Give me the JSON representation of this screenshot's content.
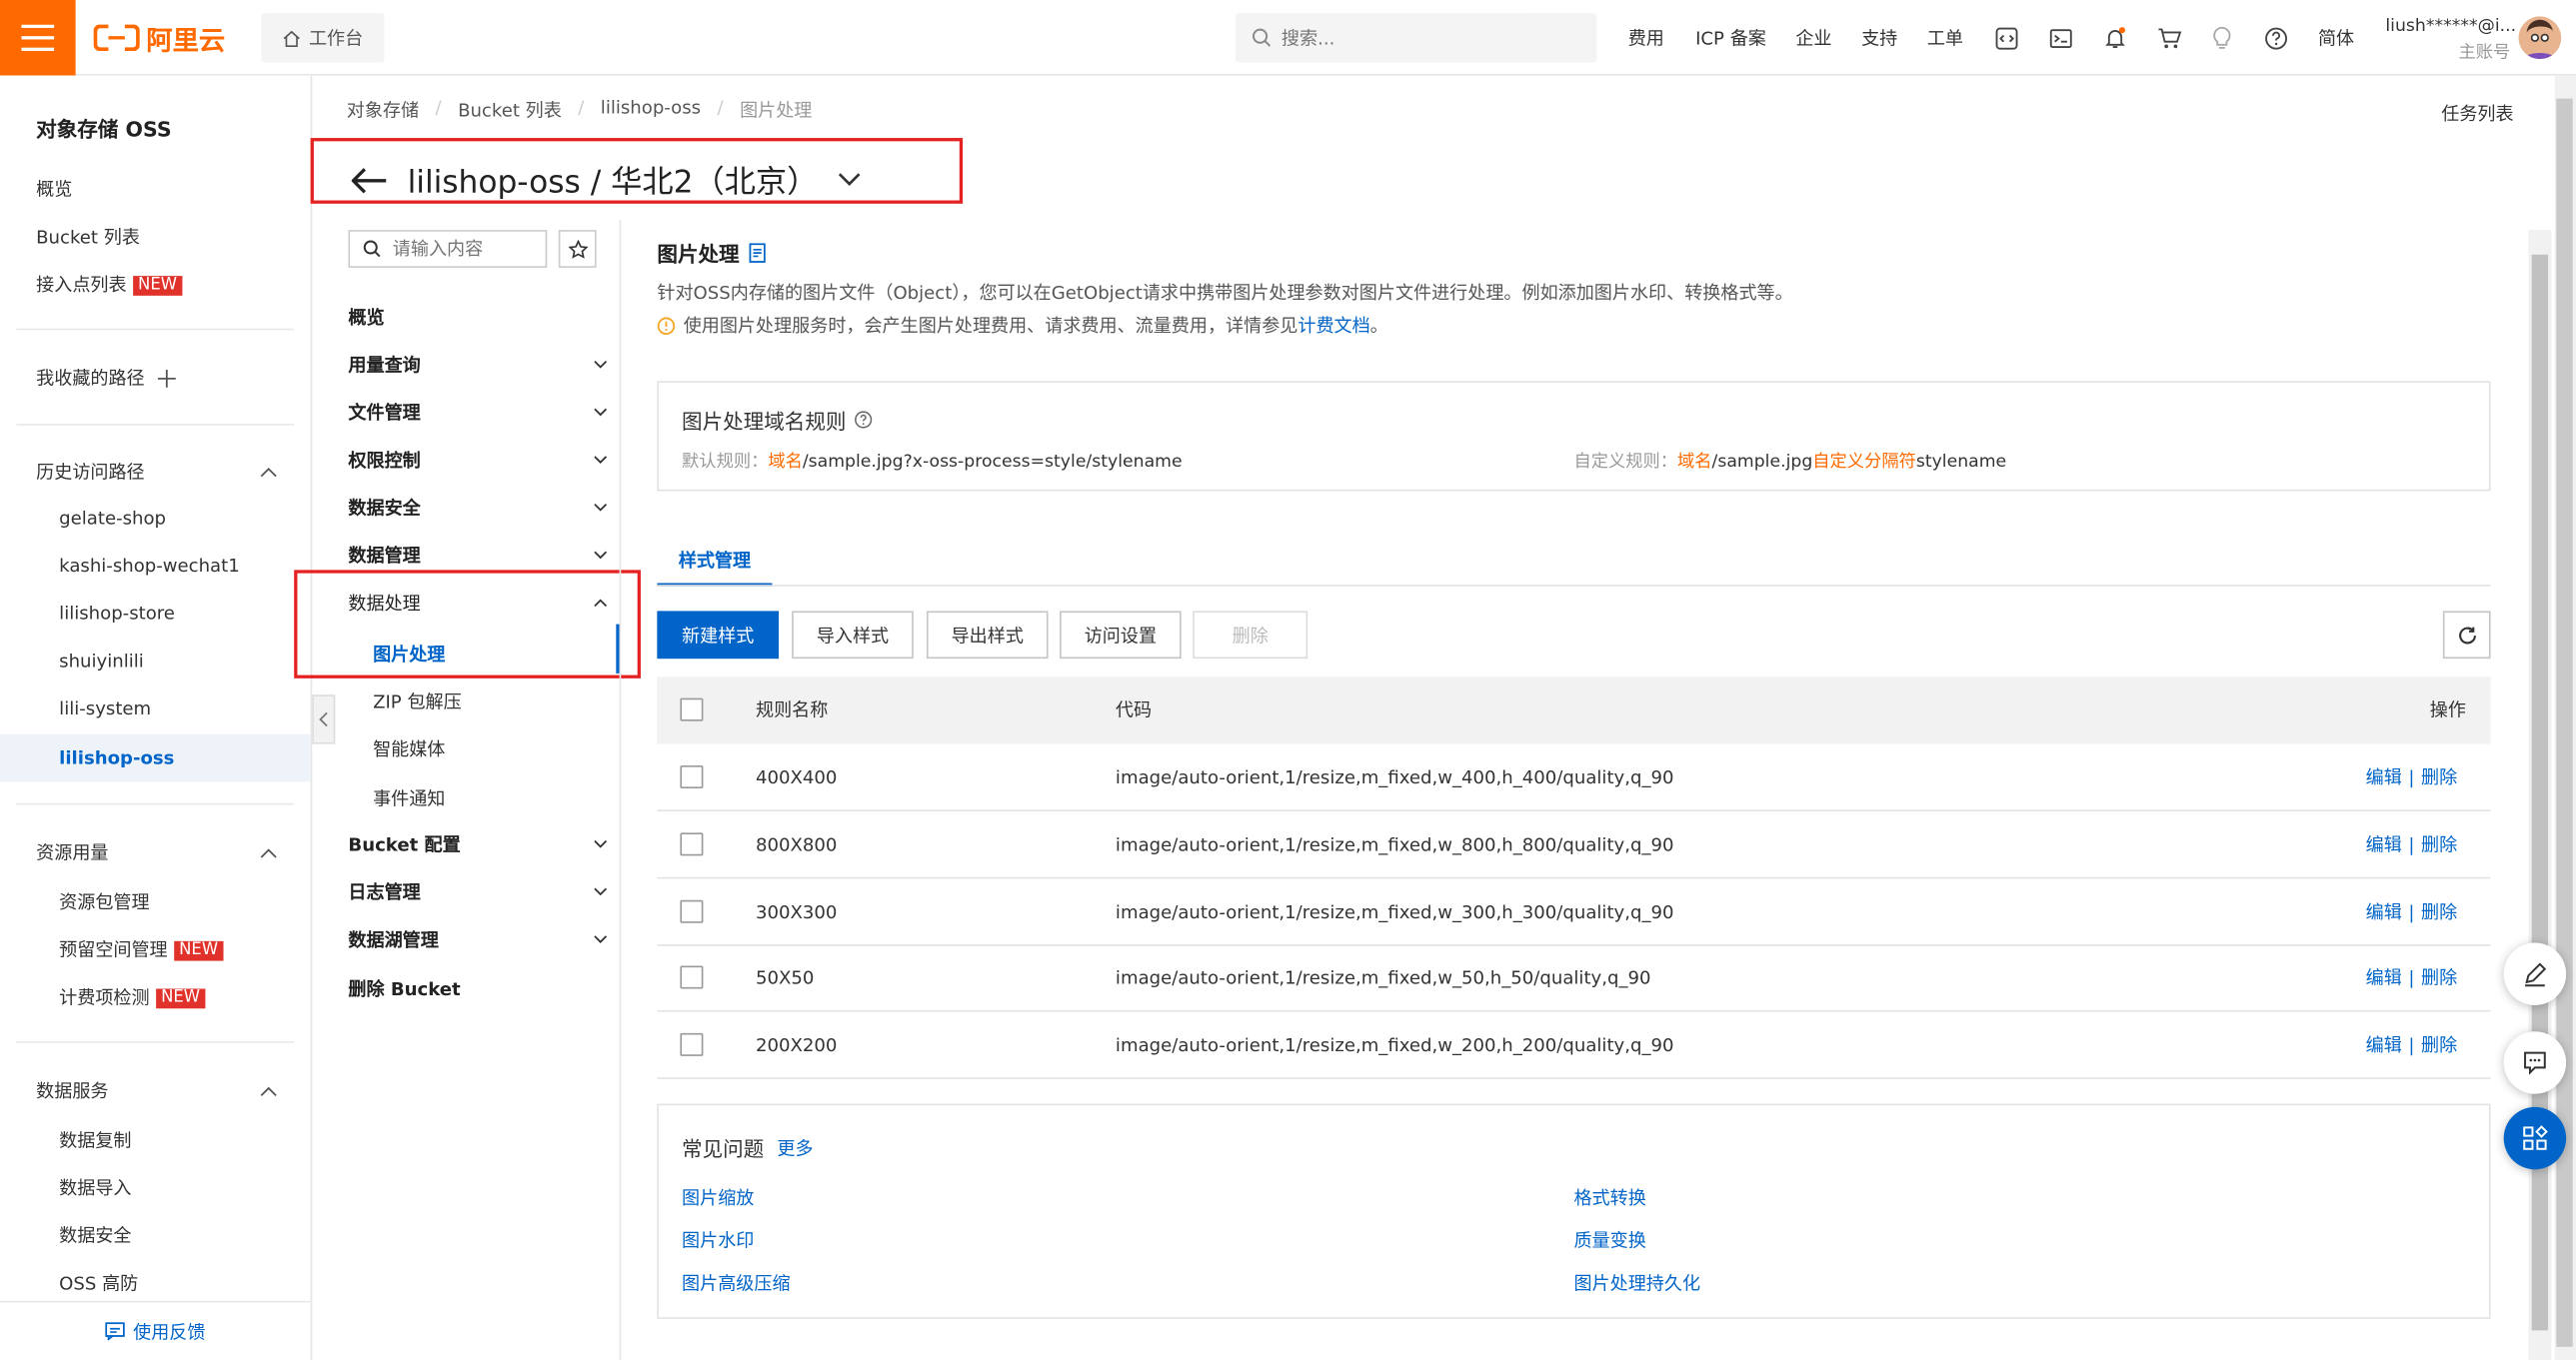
{
  "topbar": {
    "logo_text": "阿里云",
    "home_label": "工作台",
    "search_placeholder": "搜索...",
    "nav": [
      "费用",
      "ICP 备案",
      "企业",
      "支持",
      "工单"
    ],
    "lang": "简体",
    "user_name": "liush******@i...",
    "user_role": "主账号",
    "notification_dot_color": "#ff6a00"
  },
  "leftnav": {
    "title": "对象存储 OSS",
    "items": [
      "概览",
      "Bucket 列表",
      "接入点列表"
    ],
    "new_badge": "NEW",
    "favorites": "我收藏的路径",
    "history_title": "历史访问路径",
    "history": [
      "gelate-shop",
      "kashi-shop-wechat1",
      "lilishop-store",
      "shuiyinlili",
      "lili-system",
      "lilishop-oss"
    ],
    "resource_title": "资源用量",
    "resource": [
      "资源包管理",
      "预留空间管理",
      "计费项检测"
    ],
    "data_service_title": "数据服务",
    "data_service": [
      "数据复制",
      "数据导入",
      "数据安全",
      "OSS 高防"
    ],
    "feedback": "使用反馈"
  },
  "breadcrumb": [
    "对象存储",
    "Bucket 列表",
    "lilishop-oss",
    "图片处理"
  ],
  "task_list": "任务列表",
  "page_title": "lilishop-oss / 华北2（北京）",
  "subnav": {
    "search_placeholder": "请输入内容",
    "overview": "概览",
    "groups": [
      "用量查询",
      "文件管理",
      "权限控制",
      "数据安全",
      "数据管理"
    ],
    "data_processing": "数据处理",
    "processing_items": [
      "图片处理",
      "ZIP 包解压",
      "智能媒体",
      "事件通知"
    ],
    "groups2": [
      "Bucket 配置",
      "日志管理",
      "数据湖管理"
    ],
    "delete_bucket": "删除 Bucket"
  },
  "main": {
    "title": "图片处理",
    "description": "针对OSS内存储的图片文件（Object），您可以在GetObject请求中携带图片处理参数对图片文件进行处理。例如添加图片水印、转换格式等。",
    "notice": "使用图片处理服务时，会产生图片处理费用、请求费用、流量费用，详情参见",
    "notice_link": "计费文档",
    "notice_end": "。",
    "rule_box": {
      "title": "图片处理域名规则",
      "default_label": "默认规则：",
      "default_domain": "域名",
      "default_path": "/sample.jpg?x-oss-process=style/stylename",
      "custom_label": "自定义规则：",
      "custom_domain": "域名",
      "custom_mid": "/sample.jpg",
      "custom_sep": "自定义分隔符",
      "custom_end": "stylename"
    },
    "tab": "样式管理",
    "buttons": {
      "new": "新建样式",
      "import": "导入样式",
      "export": "导出样式",
      "access": "访问设置",
      "delete": "删除"
    },
    "table": {
      "headers": [
        "规则名称",
        "代码",
        "操作"
      ],
      "rows": [
        {
          "name": "400X400",
          "code": "image/auto-orient,1/resize,m_fixed,w_400,h_400/quality,q_90"
        },
        {
          "name": "800X800",
          "code": "image/auto-orient,1/resize,m_fixed,w_800,h_800/quality,q_90"
        },
        {
          "name": "300X300",
          "code": "image/auto-orient,1/resize,m_fixed,w_300,h_300/quality,q_90"
        },
        {
          "name": "50X50",
          "code": "image/auto-orient,1/resize,m_fixed,w_50,h_50/quality,q_90"
        },
        {
          "name": "200X200",
          "code": "image/auto-orient,1/resize,m_fixed,w_200,h_200/quality,q_90"
        }
      ],
      "edit": "编辑",
      "delete": "删除",
      "separator": "|"
    },
    "faq": {
      "title": "常见问题",
      "more": "更多",
      "left": [
        "图片缩放",
        "图片水印",
        "图片高级压缩"
      ],
      "right": [
        "格式转换",
        "质量变换",
        "图片处理持久化"
      ]
    }
  },
  "colors": {
    "brand": "#ff6a00",
    "link": "#0064c8",
    "highlight_box": "#e52222"
  }
}
